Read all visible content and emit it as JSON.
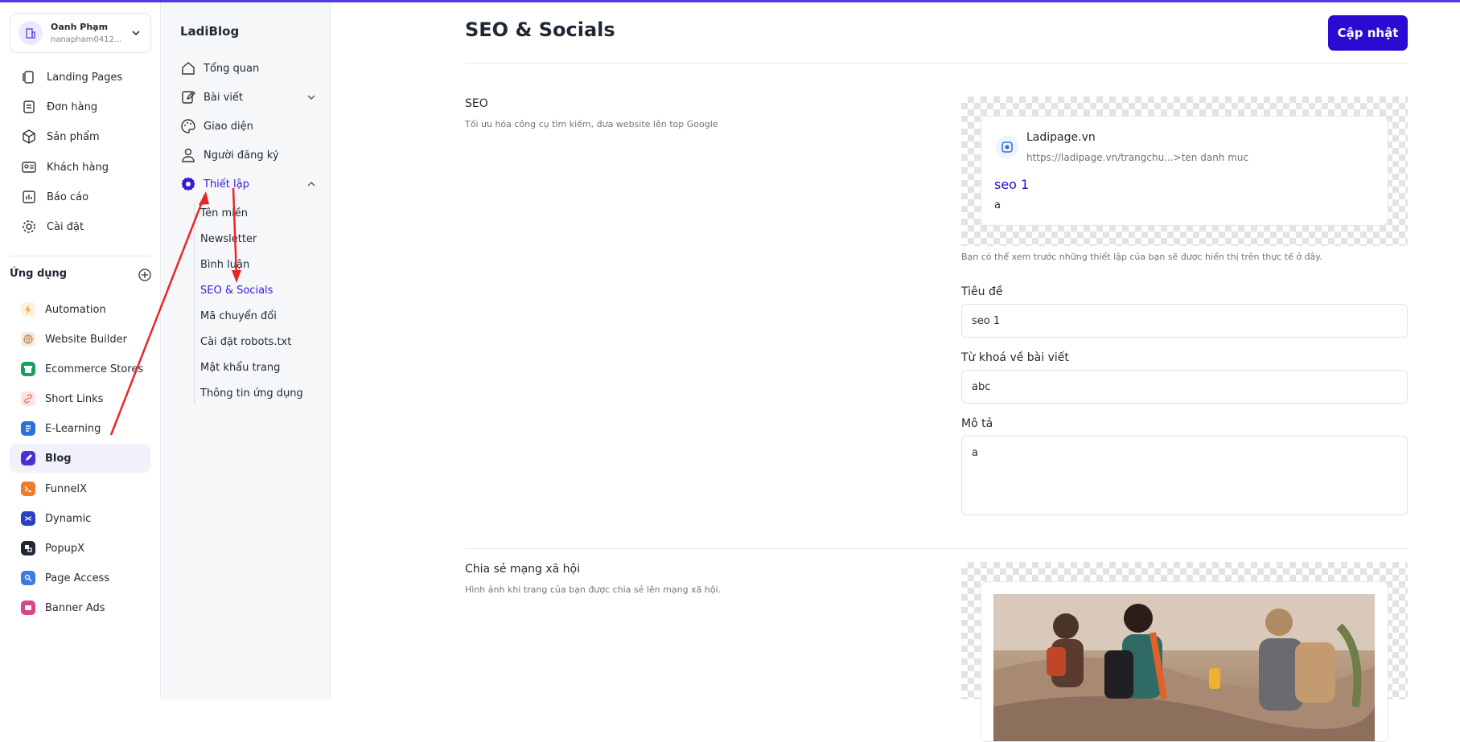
{
  "account": {
    "name": "Oanh Phạm",
    "email": "nanapham0412..."
  },
  "nav": [
    {
      "label": "Landing Pages",
      "icon": "landing-pages-icon"
    },
    {
      "label": "Đơn hàng",
      "icon": "orders-icon"
    },
    {
      "label": "Sản phẩm",
      "icon": "products-icon"
    },
    {
      "label": "Khách hàng",
      "icon": "customers-icon"
    },
    {
      "label": "Báo cáo",
      "icon": "report-icon"
    },
    {
      "label": "Cài đặt",
      "icon": "settings-icon"
    }
  ],
  "apps": {
    "title": "Ứng dụng",
    "items": [
      {
        "label": "Automation",
        "color": "#f7a23b"
      },
      {
        "label": "Website Builder",
        "color": "#c8874f"
      },
      {
        "label": "Ecommerce Stores",
        "color": "#15a35c"
      },
      {
        "label": "Short Links",
        "color": "#e06a6a"
      },
      {
        "label": "E-Learning",
        "color": "#2f6fd8"
      },
      {
        "label": "Blog",
        "color": "#4b2fd6",
        "active": true
      },
      {
        "label": "FunnelX",
        "color": "#f07a28"
      },
      {
        "label": "Dynamic",
        "color": "#2d3fc2"
      },
      {
        "label": "PopupX",
        "color": "#1f2933"
      },
      {
        "label": "Page Access",
        "color": "#3c7be0"
      },
      {
        "label": "Banner Ads",
        "color": "#d6488a"
      }
    ]
  },
  "blog_menu": {
    "title": "LadiBlog",
    "items": [
      "Tổng quan",
      "Bài viết",
      "Giao diện",
      "Người đăng ký",
      "Thiết lập"
    ],
    "settings_children": [
      "Tên miền",
      "Newsletter",
      "Bình luận",
      "SEO & Socials",
      "Mã chuyển đổi",
      "Cài đặt robots.txt",
      "Mật khẩu trang",
      "Thông tin ứng dụng"
    ]
  },
  "main": {
    "title": "SEO & Socials",
    "update_button": "Cập nhật",
    "seo": {
      "title": "SEO",
      "desc": "Tối ưu hóa công cụ tìm kiếm, đưa website lên top Google",
      "preview_site": "Ladipage.vn",
      "preview_url": "https://ladipage.vn/trangchu...>ten danh muc",
      "preview_title": "seo 1",
      "preview_desc": "a",
      "hint": "Bạn có thể xem trước những thiết lập của bạn sẽ được hiển thị trên thực tế ở đây."
    },
    "fields": {
      "title_label": "Tiêu đề",
      "title_value": "seo 1",
      "keyword_label": "Từ khoá về bài viết",
      "keyword_value": "abc",
      "desc_label": "Mô tả",
      "desc_value": "a"
    },
    "social": {
      "title": "Chia sẻ mạng xã hội",
      "desc": "Hình ảnh khi trang của bạn được chia sẻ lên mạng xã hội."
    }
  },
  "colors": {
    "accent": "#2a0bd1",
    "active_text": "#3b17d8",
    "annotation_arrow": "#e8262a"
  }
}
